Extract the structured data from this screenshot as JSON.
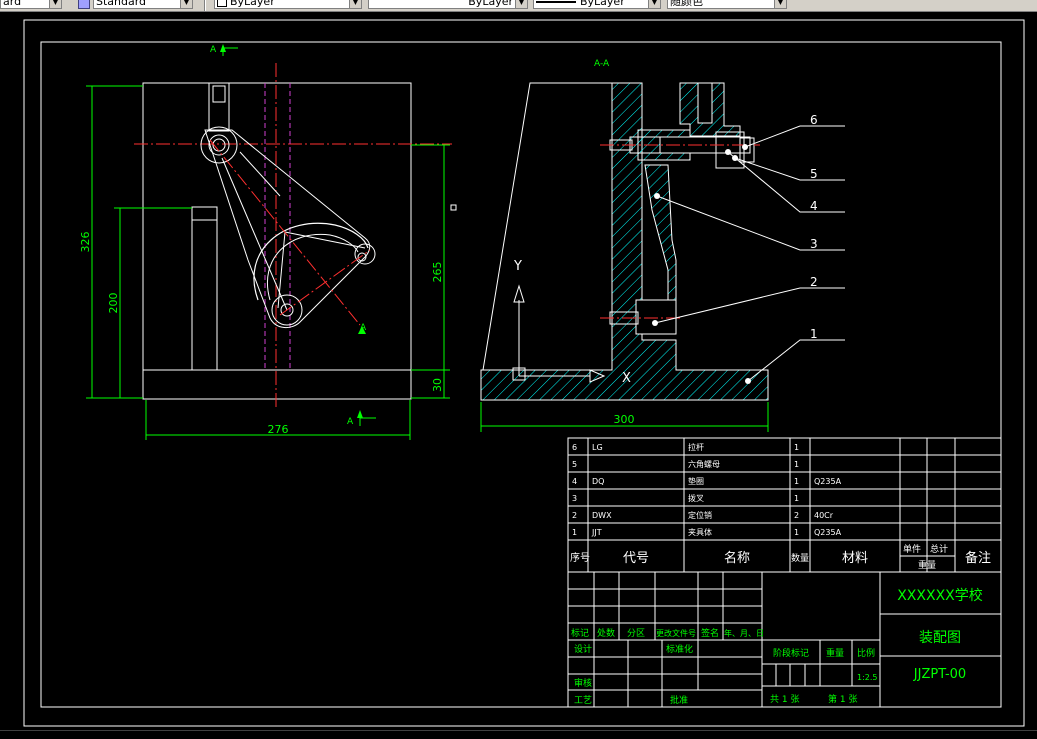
{
  "toolbar": {
    "text_style": "ard",
    "dim_style": "Standard",
    "layer": "ByLayer",
    "color": "ByLayer",
    "linetype": "ByLayer",
    "lineweight": "随颜色"
  },
  "drawing": {
    "section_label": "A-A",
    "cut_label_top": "A",
    "cut_label_bottom": "A",
    "cut_label_arm": "A",
    "axis_y": "Y",
    "axis_x": "X",
    "dims": {
      "d326": "326",
      "d200": "200",
      "d265": "265",
      "d30": "30",
      "d276": "276",
      "d300": "300"
    },
    "balloons": [
      "6",
      "5",
      "4",
      "3",
      "2",
      "1"
    ]
  },
  "bom": {
    "rows": [
      {
        "no": "6",
        "code": "LG",
        "name": "拉杆",
        "qty": "1",
        "material": ""
      },
      {
        "no": "5",
        "code": "",
        "name": "六角螺母",
        "qty": "1",
        "material": ""
      },
      {
        "no": "4",
        "code": "DQ",
        "name": "垫圈",
        "qty": "1",
        "material": "Q235A"
      },
      {
        "no": "3",
        "code": "",
        "name": "拨叉",
        "qty": "1",
        "material": ""
      },
      {
        "no": "2",
        "code": "DWX",
        "name": "定位销",
        "qty": "2",
        "material": "40Cr"
      },
      {
        "no": "1",
        "code": "JJT",
        "name": "夹具体",
        "qty": "1",
        "material": "Q235A"
      }
    ],
    "header": {
      "no": "序号",
      "code": "代号",
      "name": "名称",
      "qty": "数量",
      "material": "材料",
      "unit": "单件",
      "total": "总计",
      "weight": "重量",
      "remark": "备注"
    }
  },
  "title_block": {
    "school": "XXXXXX学校",
    "drawing_name": "装配图",
    "drawing_no": "JJZPT-00",
    "marks": [
      "标记",
      "处数",
      "分区",
      "更改文件号",
      "签名",
      "年、月、日"
    ],
    "design": "设计",
    "standardize": "标准化",
    "review": "审核",
    "process": "工艺",
    "approve": "批准",
    "stage_mark": "阶段标记",
    "weight": "重量",
    "scale_label": "比例",
    "scale": "1:2.5",
    "sheets_total": "共  1  张",
    "sheet_no": "第  1  张"
  }
}
